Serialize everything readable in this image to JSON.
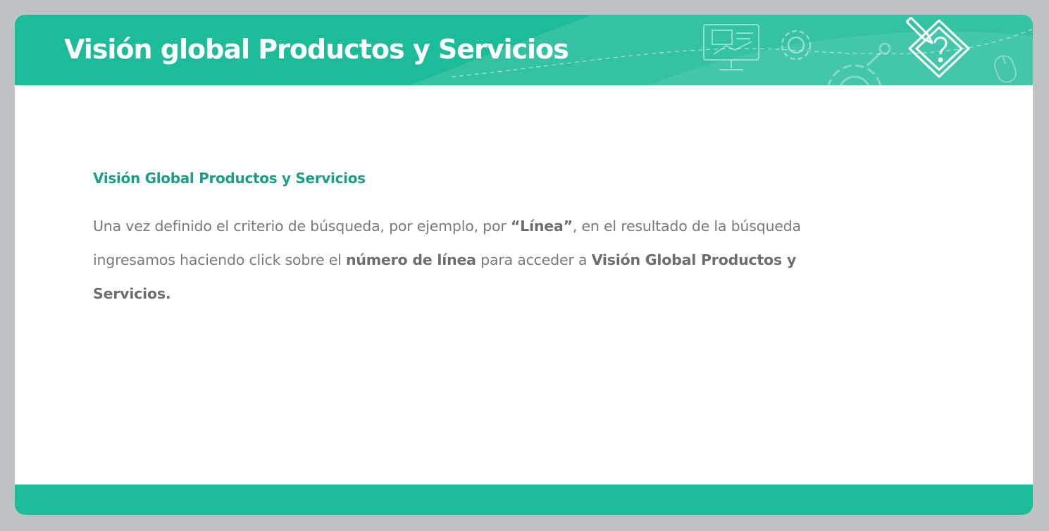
{
  "header": {
    "title": "Visión global Productos y Servicios"
  },
  "content": {
    "section_title": "Visión Global Productos y Servicios",
    "paragraph": {
      "part1": "Una vez definido el criterio de búsqueda, por ejemplo, por ",
      "bold1": "“Línea”",
      "part2": ", en el resultado de la búsqueda ingresamos haciendo click  sobre el ",
      "bold2": "número de línea",
      "part3": " para acceder a ",
      "bold3": "Visión Global Productos y Servicios."
    }
  },
  "colors": {
    "brand_green": "#1dbc99",
    "title_green": "#1a9e85",
    "body_text": "#7a7a7a",
    "frame_gray": "#bfc2c5"
  },
  "icons": [
    "monitor-presentation-icon",
    "gear-icon",
    "large-gear-icon",
    "mouse-icon",
    "pencil-question-badge-icon"
  ]
}
